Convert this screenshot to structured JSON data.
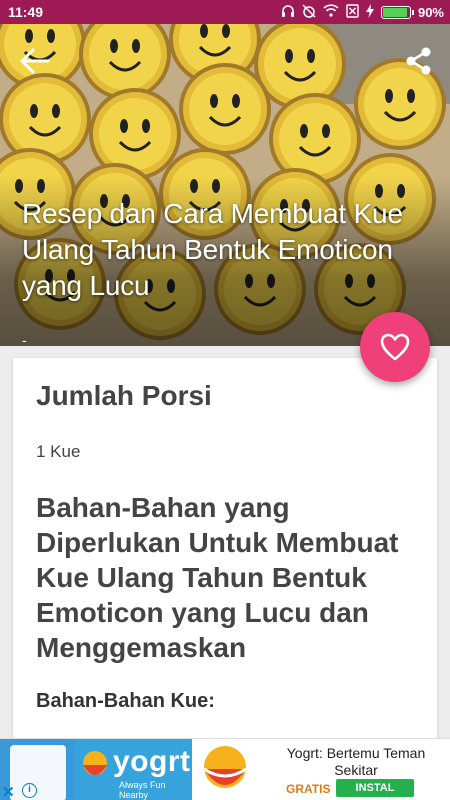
{
  "status_bar": {
    "time": "11:49",
    "battery_percent": "90%",
    "icons": [
      "gallery-icon",
      "headphones-icon",
      "alarm-off-icon",
      "wifi-icon",
      "no-sim-icon",
      "charging-icon",
      "battery-icon"
    ]
  },
  "hero": {
    "title": "Resep dan Cara Membuat Kue Ulang Tahun Bentuk Emoticon yang Lucu",
    "subtitle": "-",
    "back_icon": "arrow-left-icon",
    "share_icon": "share-icon",
    "image_description_icon": "cupcakes-photo"
  },
  "fab": {
    "icon": "heart-icon",
    "color": "#f0407a"
  },
  "content": {
    "portion_heading": "Jumlah Porsi",
    "portion_value": "1 Kue",
    "ingredients_heading": "Bahan-Bahan yang Diperlukan Untuk Membuat Kue Ulang Tahun Bentuk Emoticon yang Lucu dan Menggemaskan",
    "sub_heading": "Bahan-Bahan Kue:"
  },
  "ad": {
    "brand": "yogrt",
    "tagline": "Always Fun Nearby",
    "title": "Yogrt: Bertemu Teman Sekitar",
    "price": "GRATIS",
    "install_label": "INSTAL",
    "close_label": "✕",
    "info_label": "i"
  },
  "colors": {
    "status_bar": "#9e1a55",
    "accent": "#f0407a",
    "ad_blue": "#37a3dc",
    "install_green": "#22b14c"
  }
}
